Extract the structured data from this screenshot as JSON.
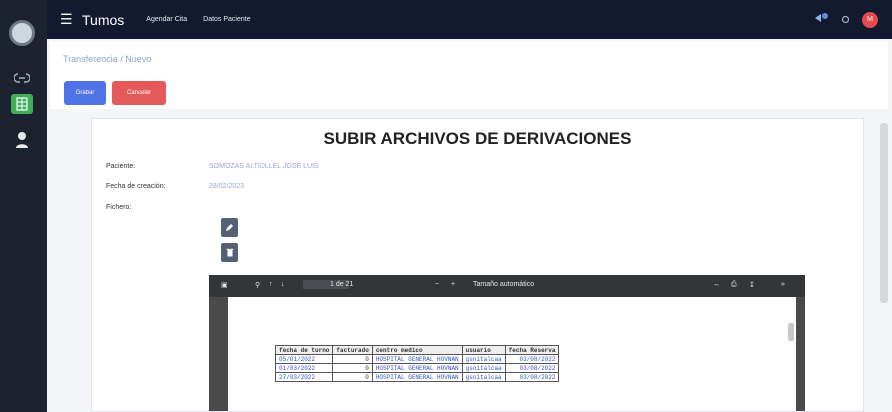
{
  "topbar": {
    "brand": "Tumos",
    "nav": [
      "Agendar Cita",
      "Datos Paciente"
    ],
    "avatar_initial": "M"
  },
  "page": {
    "breadcrumb": "Transferencia / Nuevo",
    "buttons": {
      "save": "Grabar",
      "cancel": "Cancelar"
    }
  },
  "form": {
    "title": "SUBIR ARCHIVOS DE DERIVACIONES",
    "patient_label": "Paciente:",
    "patient_value": "SOMOZAS ALTIDLLEL JOSE LUIS",
    "date_label": "Fecha de creación:",
    "date_value": "28/02/2023",
    "files_label": "Fichero:"
  },
  "pdf_viewer": {
    "page_indicator": "1 de 21",
    "zoom_label": "Tamaño automático",
    "table": {
      "headers": [
        "fecha de turno",
        "facturado",
        "centro medico",
        "usuario",
        "fecha Reserva"
      ],
      "rows": [
        [
          "05/01/2022",
          "0",
          "HOSPITAL GENERAL HOVNAN",
          "gsnitalcaa",
          "03/08/2022"
        ],
        [
          "01/03/2022",
          "0",
          "HOSPITAL GENERAL HOVNAN",
          "gsnitalcaa",
          "03/08/2022"
        ],
        [
          "27/03/2022",
          "0",
          "HOSPITAL GENERAL HOVNAN",
          "gsnitalcaa",
          "03/08/2022"
        ]
      ]
    }
  },
  "colors": {
    "sidebar": "#1d2230",
    "topbar": "#131a2f",
    "save": "#4f73e6",
    "cancel": "#e45a5a"
  }
}
